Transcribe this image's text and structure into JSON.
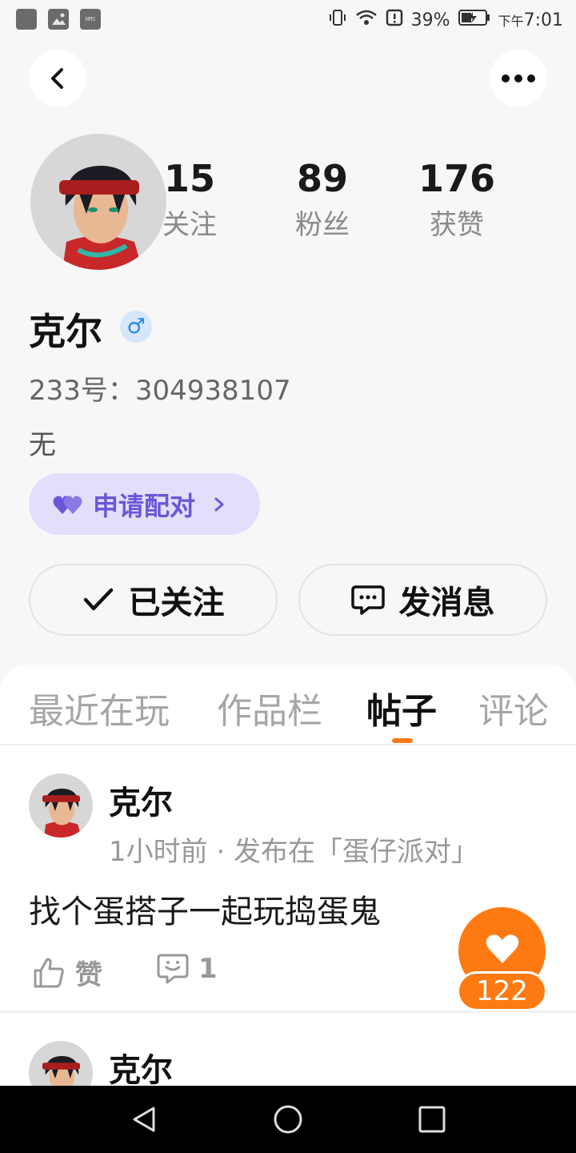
{
  "status_bar": {
    "battery": "39%",
    "time_prefix": "下午",
    "time": "7:01",
    "hms_label": "HMS"
  },
  "profile": {
    "stats": [
      {
        "value": "15",
        "label": "关注"
      },
      {
        "value": "89",
        "label": "粉丝"
      },
      {
        "value": "176",
        "label": "获赞"
      }
    ],
    "name": "克尔",
    "gender_symbol": "♂",
    "id_line": "233号：304938107",
    "bio": "无",
    "pair_label": "申请配对",
    "follow_label": "已关注",
    "message_label": "发消息"
  },
  "tabs": [
    {
      "label": "最近在玩",
      "active": false
    },
    {
      "label": "作品栏",
      "active": false
    },
    {
      "label": "帖子",
      "active": true
    },
    {
      "label": "评论",
      "active": false
    }
  ],
  "posts": [
    {
      "author": "克尔",
      "meta": "1小时前 · 发布在「蛋仔派对」",
      "text": "找个蛋搭子一起玩捣蛋鬼",
      "like_label": "赞",
      "comment_count": "1"
    },
    {
      "author": "克尔"
    }
  ],
  "like_fab": {
    "count": "122"
  },
  "colors": {
    "accent": "#ff7a12",
    "pair_bg": "#e3defa",
    "pair_text": "#6d55d8"
  }
}
